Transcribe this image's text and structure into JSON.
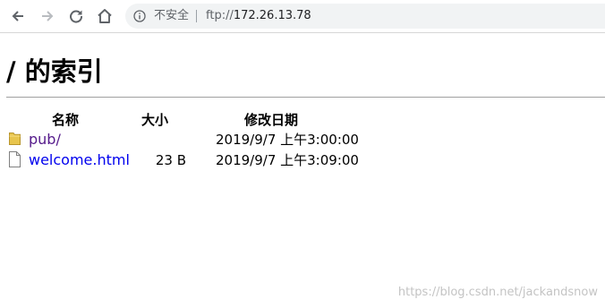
{
  "browser": {
    "security_label": "不安全",
    "url_scheme": "ftp://",
    "url_host": "172.26.13.78"
  },
  "page": {
    "title": "/ 的索引",
    "columns": {
      "name": "名称",
      "size": "大小",
      "modified": "修改日期"
    },
    "entries": [
      {
        "name": "pub/",
        "size": "",
        "modified": "2019/9/7 上午3:00:00",
        "type": "folder",
        "icon": "folder-icon"
      },
      {
        "name": "welcome.html",
        "size": "23 B",
        "modified": "2019/9/7 上午3:09:00",
        "type": "file",
        "icon": "file-icon"
      }
    ]
  },
  "watermark": "https://blog.csdn.net/jackandsnow",
  "colors": {
    "link": "#0000ee",
    "visited_link": "#551a8b",
    "omnibox_bg": "#f1f3f4"
  }
}
